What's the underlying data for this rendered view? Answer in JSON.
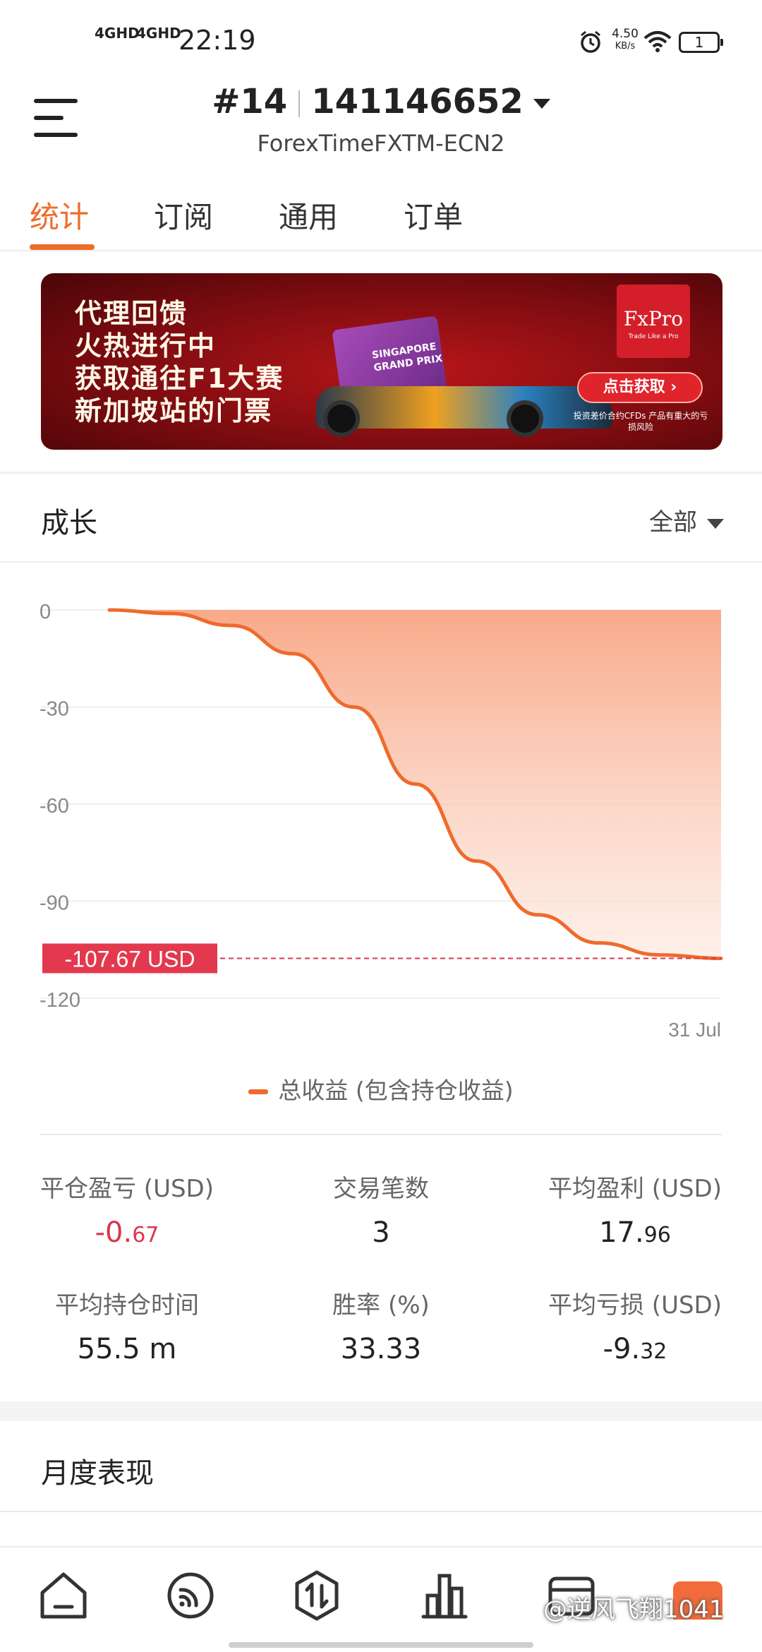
{
  "status_bar": {
    "signal1": "4GHD",
    "signal2": "4GHD",
    "time": "22:19",
    "net_speed_value": "4.50",
    "net_speed_unit": "KB/s",
    "battery": "1"
  },
  "header": {
    "account_index": "#14",
    "account_number": "141146652",
    "server": "ForexTimeFXTM-ECN2"
  },
  "tabs": [
    {
      "label": "统计",
      "active": true
    },
    {
      "label": "订阅",
      "active": false
    },
    {
      "label": "通用",
      "active": false
    },
    {
      "label": "订单",
      "active": false
    }
  ],
  "banner": {
    "lines": [
      "代理回馈",
      "火热进行中",
      "获取通往F1大赛",
      "新加坡站的门票"
    ],
    "ticket_text": "SINGAPORE GRAND PRIX",
    "brand": "FxPro",
    "brand_tagline": "Trade Like a Pro",
    "cta": "点击获取",
    "risk_note": "投资差价合约CFDs 产品有重大的亏损风险"
  },
  "growth": {
    "title": "成长",
    "filter": "全部"
  },
  "chart_data": {
    "type": "area",
    "series": [
      {
        "name": "总收益 (包含持仓收益)",
        "color": "#ef6a2c",
        "points": [
          [
            0,
            0
          ],
          [
            0.1,
            -1.1
          ],
          [
            0.2,
            -4.8
          ],
          [
            0.3,
            -13.5
          ],
          [
            0.4,
            -30.0
          ],
          [
            0.5,
            -53.8
          ],
          [
            0.6,
            -77.6
          ],
          [
            0.7,
            -94.2
          ],
          [
            0.8,
            -102.9
          ],
          [
            0.9,
            -106.6
          ],
          [
            1.0,
            -107.67
          ]
        ]
      }
    ],
    "y_ticks": [
      "0",
      "-30",
      "-60",
      "-90",
      "-120"
    ],
    "ylim": [
      -120,
      0
    ],
    "x_tick_labels": [
      "31 Jul"
    ],
    "current_value_label": "-107.67 USD",
    "current_value": -107.67,
    "grid": true
  },
  "stats": [
    {
      "label": "平仓盈亏 (USD)",
      "value_main": "-0.",
      "value_small": "67",
      "negative": true
    },
    {
      "label": "交易笔数",
      "value_main": "3",
      "value_small": "",
      "negative": false
    },
    {
      "label": "平均盈利 (USD)",
      "value_main": "17.",
      "value_small": "96",
      "negative": false
    },
    {
      "label": "平均持仓时间",
      "value_main": "55.5 m",
      "value_small": "",
      "negative": false
    },
    {
      "label": "胜率 (%)",
      "value_main": "33.33",
      "value_small": "",
      "negative": false
    },
    {
      "label": "平均亏损 (USD)",
      "value_main": "-9.",
      "value_small": "32",
      "negative": false
    }
  ],
  "monthly": {
    "title": "月度表现"
  },
  "watermark": "@逆风飞翔1041",
  "colors": {
    "accent": "#ee6c2a",
    "negative": "#d9364d",
    "value_label_bg": "#e2394f"
  }
}
